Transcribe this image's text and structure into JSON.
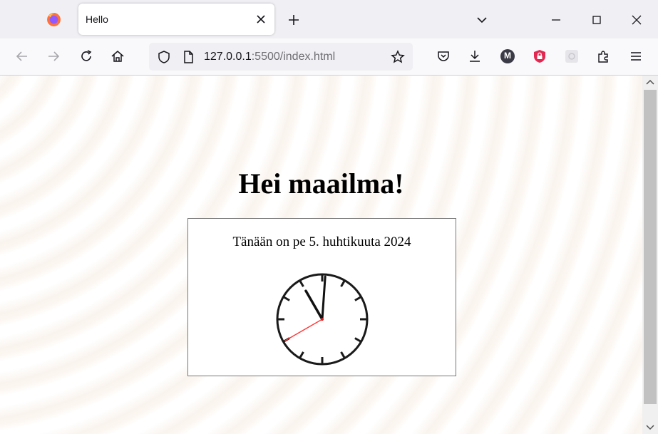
{
  "browser": {
    "tab": {
      "title": "Hello"
    },
    "url": {
      "host": "127.0.0.1",
      "rest": ":5500/index.html"
    },
    "icons": {
      "back": "arrow-left-icon",
      "forward": "arrow-right-icon",
      "reload": "reload-icon",
      "home": "home-icon",
      "shield": "shield-icon",
      "page": "page-icon",
      "bookmark": "star-icon",
      "pocket": "pocket-icon",
      "downloads": "download-icon",
      "account": "account-icon",
      "extensions": "puzzle-icon",
      "menu": "hamburger-icon"
    },
    "account_initial": "M"
  },
  "page": {
    "heading": "Hei maailma!",
    "date_text": "Tänään on pe 5. huhtikuuta 2024"
  },
  "clock": {
    "hour": 11,
    "minute": 0,
    "second": 40,
    "hand_color": "#111111",
    "second_hand_color": "#ff3b3b"
  }
}
